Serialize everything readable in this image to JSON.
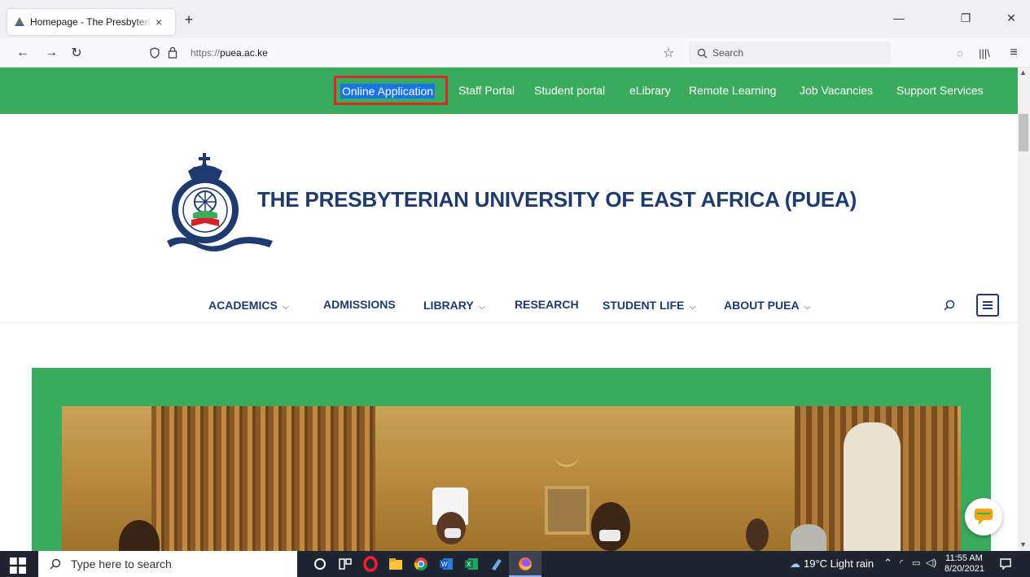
{
  "browser": {
    "tab_title": "Homepage - The Presbyterian U",
    "tab_close": "×",
    "new_tab": "+",
    "url_prefix": "https://",
    "url_domain": "puea.ac.ke",
    "search_placeholder": "Search"
  },
  "topbar": {
    "links": [
      "Online Application",
      "Staff Portal",
      "Student portal",
      "eLibrary",
      "Remote Learning",
      "Job Vacancies",
      "Support Services"
    ]
  },
  "header": {
    "title": "THE PRESBYTERIAN UNIVERSITY OF EAST AFRICA (PUEA)"
  },
  "mainmenu": {
    "items": [
      {
        "label": "ACADEMICS",
        "dropdown": true
      },
      {
        "label": "ADMISSIONS",
        "dropdown": false
      },
      {
        "label": "LIBRARY",
        "dropdown": true
      },
      {
        "label": "RESEARCH",
        "dropdown": false
      },
      {
        "label": "STUDENT LIFE",
        "dropdown": true
      },
      {
        "label": "ABOUT PUEA",
        "dropdown": true
      }
    ]
  },
  "taskbar": {
    "search_placeholder": "Type here to search",
    "weather": "19°C  Light rain",
    "time": "11:55 AM",
    "date": "8/20/2021"
  },
  "colors": {
    "brand_green": "#3aaa5c",
    "brand_navy": "#1e3a6e",
    "highlight_red": "#d82b2b"
  }
}
